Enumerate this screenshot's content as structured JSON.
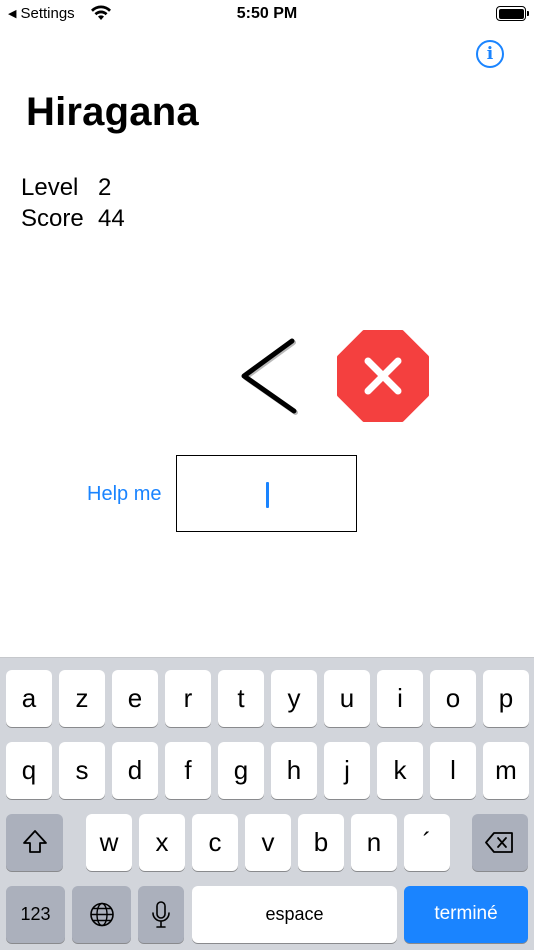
{
  "status_bar": {
    "back_label": "Settings",
    "time": "5:50 PM"
  },
  "header": {
    "title": "Hiragana",
    "info_glyph": "i"
  },
  "stats": {
    "level_label": "Level",
    "level_value": "2",
    "score_label": "Score",
    "score_value": "44"
  },
  "quiz": {
    "character": "く",
    "result": "wrong",
    "result_color": "#f4403f",
    "help_label": "Help me",
    "answer_value": ""
  },
  "keyboard": {
    "row1": [
      "a",
      "z",
      "e",
      "r",
      "t",
      "y",
      "u",
      "i",
      "o",
      "p"
    ],
    "row2": [
      "q",
      "s",
      "d",
      "f",
      "g",
      "h",
      "j",
      "k",
      "l",
      "m"
    ],
    "row3": [
      "w",
      "x",
      "c",
      "v",
      "b",
      "n",
      "´"
    ],
    "numbers_label": "123",
    "space_label": "espace",
    "done_label": "terminé",
    "accent_color": "#1a84ff"
  }
}
